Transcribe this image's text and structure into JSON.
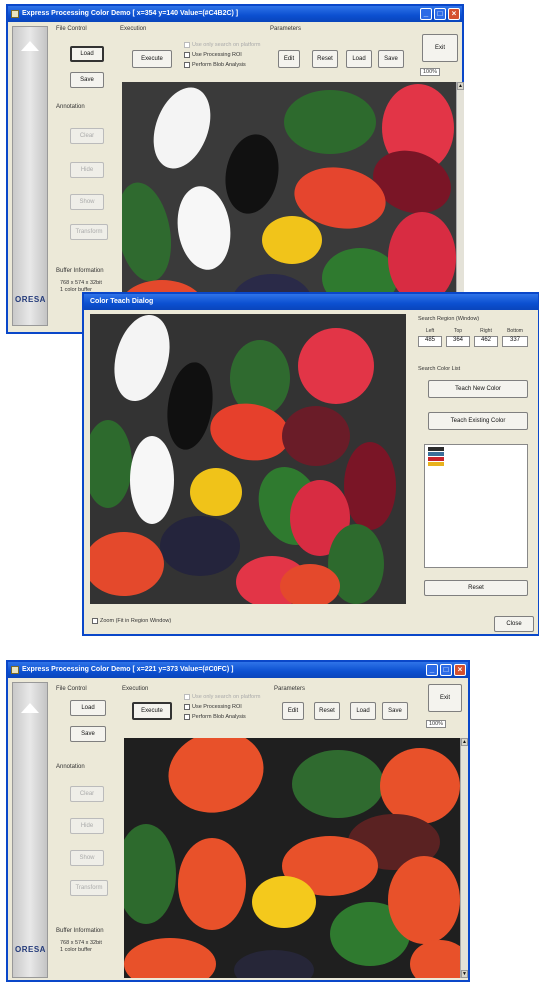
{
  "window1": {
    "title": "Express Processing Color Demo  [ x=354 y=140 Value=(#C4B2C) ]",
    "title_icons": [
      "minimize-icon",
      "maximize-icon",
      "close-icon"
    ],
    "groups": {
      "file_control": "File Control",
      "execution": "Execution",
      "parameters": "Parameters",
      "annotation": "Annotation",
      "buffer_information": "Buffer Information"
    },
    "file_buttons": [
      "Load",
      "Save"
    ],
    "execute_label": "Execute",
    "checkboxes": [
      {
        "label": "Use only search on platform",
        "disabled": true
      },
      {
        "label": "Use Processing ROI",
        "disabled": false
      },
      {
        "label": "Perform Blob Analysis",
        "disabled": false
      }
    ],
    "param_buttons": [
      "Edit",
      "Reset",
      "Load",
      "Save"
    ],
    "exit_label": "Exit",
    "zoom_value": "100%",
    "annotation_buttons": [
      "Clear",
      "Hide",
      "Show",
      "Transform"
    ],
    "buffer_text": "768 x 574 x 32bit",
    "buffer_text2": "1 color buffer",
    "logo": "ORESA"
  },
  "dialog": {
    "title": "Color Teach Dialog",
    "search_region_title": "Search Region (Window)",
    "rect_headers": [
      "Left",
      "Top",
      "Right",
      "Bottom"
    ],
    "rect_values": [
      "485",
      "364",
      "462",
      "337"
    ],
    "search_color_list": "Search Color List",
    "teach_new_color": "Teach New Color",
    "teach_existing_color": "Teach Existing Color",
    "color_swatches": [
      "#2b2b2b",
      "#3a6f9a",
      "#c8232c",
      "#e8b21d"
    ],
    "reset_label": "Reset",
    "zoom_checkbox": "Zoom (Fit in Region Window)",
    "close_label": "Close"
  },
  "window2": {
    "title": "Express Processing Color Demo  [ x=221 y=373 Value=(#C0FC) ]",
    "title_icons": [
      "minimize-icon",
      "maximize-icon",
      "close-icon"
    ],
    "groups": {
      "file_control": "File Control",
      "execution": "Execution",
      "parameters": "Parameters",
      "annotation": "Annotation",
      "buffer_information": "Buffer Information"
    },
    "file_buttons": [
      "Load",
      "Save"
    ],
    "execute_label": "Execute",
    "checkboxes": [
      {
        "label": "Use only search on platform",
        "disabled": true
      },
      {
        "label": "Use Processing ROI",
        "disabled": false
      },
      {
        "label": "Perform Blob Analysis",
        "disabled": false
      }
    ],
    "param_buttons": [
      "Edit",
      "Reset",
      "Load",
      "Save"
    ],
    "exit_label": "Exit",
    "zoom_value": "100%",
    "annotation_buttons": [
      "Clear",
      "Hide",
      "Show",
      "Transform"
    ],
    "buffer_text": "768 x 574 x 32bit",
    "buffer_text2": "1 color buffer",
    "logo": "ORESA"
  },
  "colors": {
    "titlebar": "#0b4fd0",
    "window_bg": "#ece9d8",
    "viewport_bg": "#2a2a2a"
  }
}
